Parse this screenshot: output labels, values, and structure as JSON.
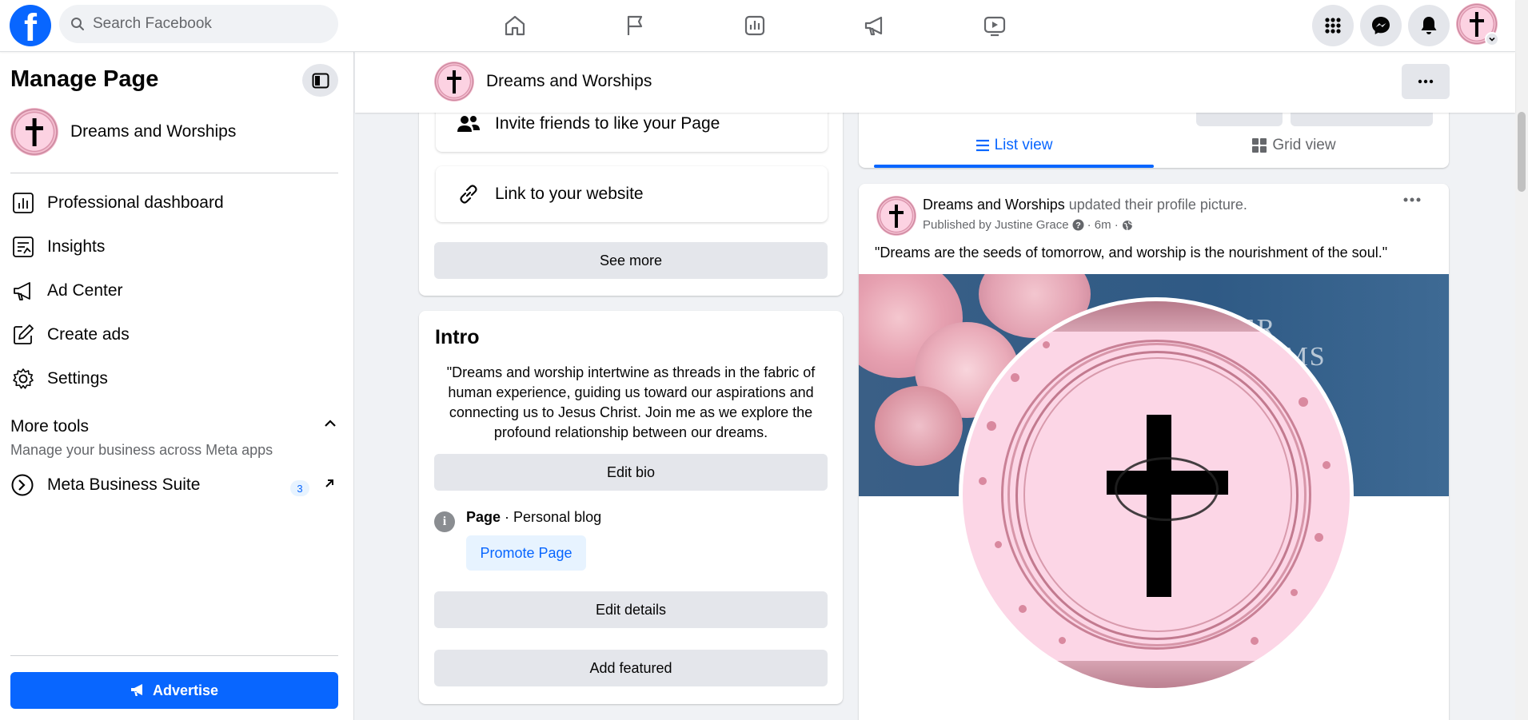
{
  "topbar": {
    "logo": "facebook-logo",
    "search_placeholder": "Search Facebook",
    "nav_icons": [
      "home-icon",
      "flag-icon",
      "insights-icon",
      "megaphone-icon",
      "video-icon"
    ],
    "right_icons": [
      "menu-grid-icon",
      "messenger-icon",
      "notifications-icon"
    ]
  },
  "sidebar": {
    "title": "Manage Page",
    "page_name": "Dreams and Worships",
    "items": [
      {
        "label": "Professional dashboard",
        "icon": "dashboard-icon"
      },
      {
        "label": "Insights",
        "icon": "insights-icon"
      },
      {
        "label": "Ad Center",
        "icon": "megaphone-icon"
      },
      {
        "label": "Create ads",
        "icon": "edit-icon"
      },
      {
        "label": "Settings",
        "icon": "gear-icon"
      }
    ],
    "more_tools": {
      "title": "More tools",
      "subtitle": "Manage your business across Meta apps",
      "suite_label": "Meta Business Suite",
      "suite_badge": "3"
    },
    "advertise_label": "Advertise"
  },
  "page_header": {
    "name": "Dreams and Worships"
  },
  "actions": {
    "invite_label": "Invite friends to like your Page",
    "link_label": "Link to your website",
    "see_more_label": "See more"
  },
  "intro": {
    "title": "Intro",
    "bio": "\"Dreams and worship intertwine as threads in the fabric of human experience, guiding us toward our aspirations and connecting us to Jesus Christ. Join me as we explore the profound relationship between our dreams.",
    "edit_bio_label": "Edit bio",
    "category_prefix": "Page",
    "category": " · Personal blog",
    "promote_label": "Promote Page",
    "edit_details_label": "Edit details",
    "add_featured_label": "Add featured"
  },
  "view_tabs": {
    "list_label": "List view",
    "grid_label": "Grid view",
    "active": "list"
  },
  "post": {
    "author": "Dreams and Worships",
    "action": " updated their profile picture.",
    "meta_prefix": "Published by Justine Grace",
    "time": "6m",
    "text": "\"Dreams are the seeds of tomorrow, and worship is the nourishment of the soul.\"",
    "cover_text_1": "ER",
    "cover_text_2": "AMS"
  }
}
